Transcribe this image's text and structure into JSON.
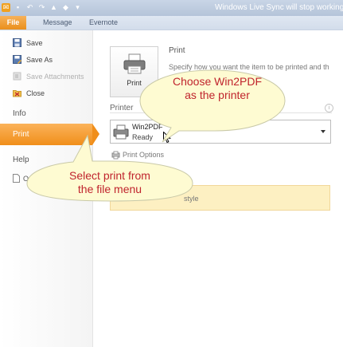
{
  "window": {
    "title": "Windows Live Sync will stop working so"
  },
  "ribbon": {
    "tabs": [
      "File",
      "Message",
      "Evernote"
    ]
  },
  "nav": {
    "commands": [
      {
        "label": "Save",
        "icon": "save-icon",
        "disabled": false
      },
      {
        "label": "Save As",
        "icon": "save-as-icon",
        "disabled": false
      },
      {
        "label": "Save Attachments",
        "icon": "paperclip-icon",
        "disabled": true
      },
      {
        "label": "Close",
        "icon": "close-folder-icon",
        "disabled": false
      }
    ],
    "sections": {
      "info": "Info",
      "print": "Print",
      "help": "Help"
    },
    "help_item": "O"
  },
  "print": {
    "button_label": "Print",
    "heading": "Print",
    "description": "Specify how you want the item to be printed and th"
  },
  "printer": {
    "heading": "Printer",
    "name": "Win2PDF",
    "status": "Ready",
    "options_label": "Print Options"
  },
  "settings": {
    "text": "style"
  },
  "callouts": {
    "choose_printer": [
      "Choose Win2PDF",
      "as the printer"
    ],
    "select_print": [
      "Select print from",
      "the file menu"
    ]
  },
  "colors": {
    "accent": "#f08e1a",
    "callout_text": "#c0242d",
    "callout_fill": "#fefbd2"
  }
}
